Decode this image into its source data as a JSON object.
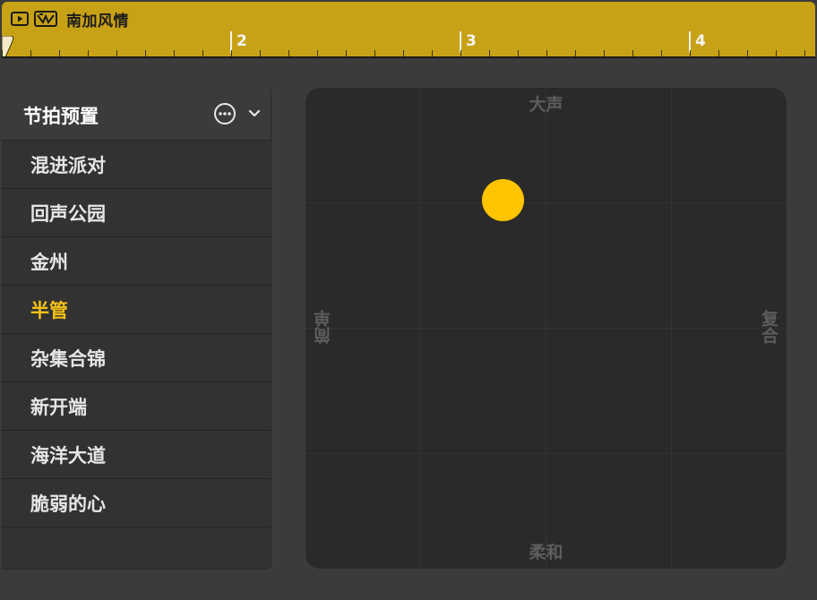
{
  "region": {
    "title": "南加风情",
    "ruler_marks": [
      "2",
      "3",
      "4"
    ],
    "color": "#c8a216"
  },
  "sidebar": {
    "title": "节拍预置",
    "more_icon": "ellipsis-circle-icon",
    "chevron_icon": "chevron-down-icon",
    "presets": [
      {
        "label": "混进派对",
        "selected": false
      },
      {
        "label": "回声公园",
        "selected": false
      },
      {
        "label": "金州",
        "selected": false
      },
      {
        "label": "半管",
        "selected": true
      },
      {
        "label": "杂集合锦",
        "selected": false
      },
      {
        "label": "新开端",
        "selected": false
      },
      {
        "label": "海洋大道",
        "selected": false
      },
      {
        "label": "脆弱的心",
        "selected": false
      }
    ],
    "selected_color": "#f6c218"
  },
  "xy_pad": {
    "top_label": "大声",
    "bottom_label": "柔和",
    "left_label": "简单",
    "right_label": "复合",
    "puck_color": "#ffc400"
  }
}
